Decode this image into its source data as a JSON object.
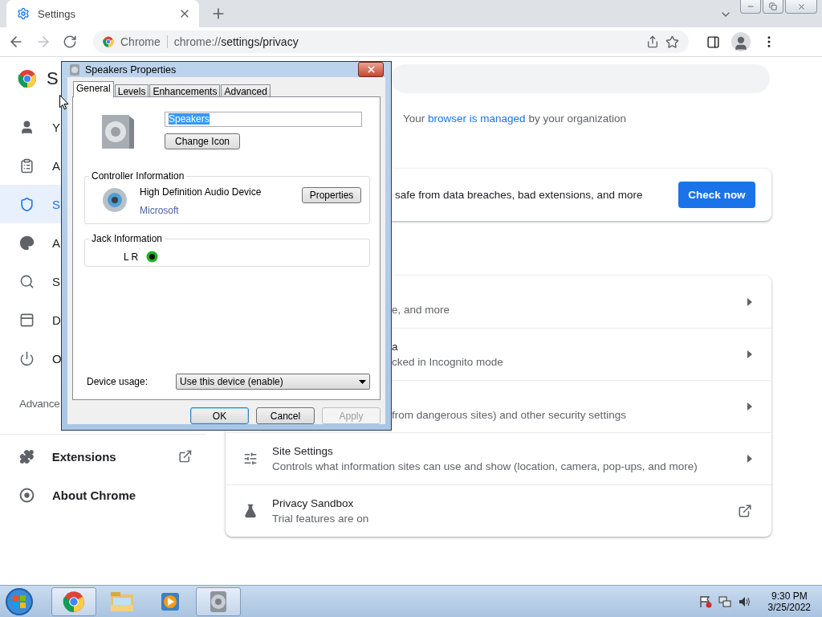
{
  "browser": {
    "tabs": [
      {
        "title": "Settings",
        "selected": true
      }
    ],
    "omnibox": {
      "site_label": "Chrome",
      "url_host": "chrome://",
      "url_path": "settings/privacy"
    }
  },
  "settings": {
    "title": "S",
    "sidebar": [
      {
        "label": "Y",
        "selected": false
      },
      {
        "label": "A",
        "selected": false
      },
      {
        "label": "S",
        "selected": true
      },
      {
        "label": "A",
        "selected": false
      },
      {
        "label": "S",
        "selected": false
      },
      {
        "label": "D",
        "selected": false
      },
      {
        "label": "O",
        "selected": false
      }
    ],
    "advanced": "Advance",
    "links": [
      {
        "label": "Extensions",
        "external": true
      },
      {
        "label": "About Chrome",
        "external": false
      }
    ],
    "managed_notice": {
      "before": "Your",
      "link": "browser is managed",
      "after": "by your organization"
    },
    "safety_check": {
      "description": "safe from data breaches, bad extensions, and more",
      "button": "Check now"
    },
    "privacy_rows": [
      {
        "description": "e, and more",
        "kind": "submenu"
      },
      {
        "title": "a",
        "description": "cked in Incognito mode",
        "kind": "submenu"
      },
      {
        "description": "from dangerous sites) and other security settings",
        "kind": "submenu"
      },
      {
        "title": "Site Settings",
        "description": "Controls what information sites can use and show (location, camera, pop-ups, and more)",
        "kind": "submenu"
      },
      {
        "title": "Privacy Sandbox",
        "description": "Trial features are on",
        "kind": "external"
      }
    ]
  },
  "dialog": {
    "title": "Speakers Properties",
    "tabs": [
      {
        "label": "General",
        "selected": true
      },
      {
        "label": "Levels",
        "selected": false
      },
      {
        "label": "Enhancements",
        "selected": false
      },
      {
        "label": "Advanced",
        "selected": false
      }
    ],
    "name_field": {
      "value": "Speakers",
      "text_selected": true
    },
    "change_icon": "Change Icon",
    "controller": {
      "heading": "Controller Information",
      "device": "High Definition Audio Device",
      "vendor": "Microsoft",
      "button": "Properties"
    },
    "jack": {
      "heading": "Jack Information",
      "label": "L R"
    },
    "device_usage": {
      "label": "Device usage:",
      "value": "Use this device (enable)"
    },
    "buttons": [
      {
        "label": "OK",
        "default": true,
        "disabled": false
      },
      {
        "label": "Cancel",
        "default": false,
        "disabled": false
      },
      {
        "label": "Apply",
        "default": false,
        "disabled": true
      }
    ]
  },
  "taskbar": {
    "apps": [
      {
        "kind": "chrome",
        "highlighted": true
      },
      {
        "kind": "explorer",
        "highlighted": false
      },
      {
        "kind": "media",
        "highlighted": false
      },
      {
        "kind": "speaker",
        "highlighted": true
      }
    ],
    "clock": {
      "time": "9:30 PM",
      "date": "3/25/2022"
    }
  }
}
